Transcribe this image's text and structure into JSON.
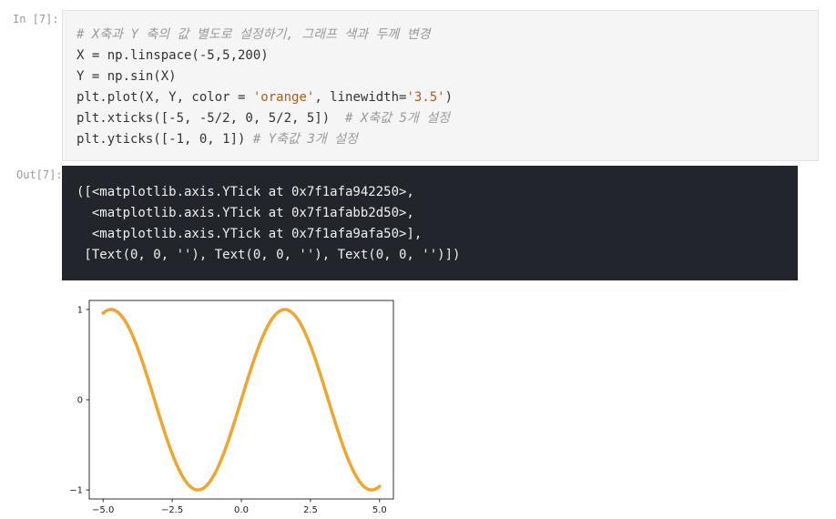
{
  "input_cell": {
    "prompt": "In [7]:",
    "lines": [
      {
        "comment": "# X축과 Y 축의 값 별도로 설정하기, 그래프 색과 두께 변경"
      },
      {
        "code": "X = np.linspace(-5,5,200)"
      },
      {
        "code": "Y = np.sin(X)"
      },
      {
        "code_pre": "plt.plot(X, Y, color = ",
        "string1": "'orange'",
        "code_mid": ", linewidth=",
        "string2": "'3.5'",
        "code_post": ")"
      },
      {
        "code": "plt.xticks([-5, -5/2, 0, 5/2, 5])  ",
        "comment": "# X축값 5개 설정"
      },
      {
        "code": "plt.yticks([-1, 0, 1]) ",
        "comment": "# Y축값 3개 설정"
      }
    ]
  },
  "output_cell": {
    "prompt": "Out[7]:",
    "lines": [
      "([<matplotlib.axis.YTick at 0x7f1afa942250>,",
      "  <matplotlib.axis.YTick at 0x7f1afabb2d50>,",
      "  <matplotlib.axis.YTick at 0x7f1afa9afa50>],",
      " [Text(0, 0, ''), Text(0, 0, ''), Text(0, 0, '')])"
    ]
  },
  "chart_data": {
    "type": "line",
    "function": "sin",
    "x_range": [
      -5,
      5
    ],
    "num_points": 200,
    "series": [
      {
        "color": "#eea62f",
        "linewidth": 3.5
      }
    ],
    "xticks": [
      -5.0,
      -2.5,
      0.0,
      2.5,
      5.0
    ],
    "xtick_labels": [
      "−5.0",
      "−2.5",
      "0.0",
      "2.5",
      "5.0"
    ],
    "yticks": [
      -1,
      0,
      1
    ],
    "ytick_labels": [
      "−1",
      "0",
      "1"
    ],
    "xlim": [
      -5.5,
      5.5
    ],
    "ylim": [
      -1.1,
      1.1
    ],
    "grid": false
  }
}
